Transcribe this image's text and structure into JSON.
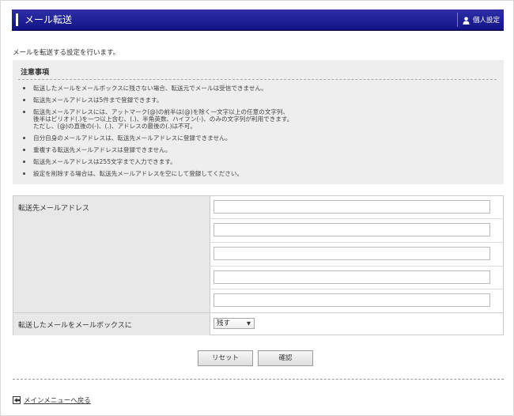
{
  "header": {
    "title": "メール転送",
    "profile_label": "個人設定"
  },
  "intro": "メールを転送する設定を行います。",
  "notice": {
    "heading": "注意事項",
    "items": [
      [
        "転送したメールをメールボックスに残さない場合、転送元でメールは受信できません。"
      ],
      [
        "転送先メールアドレスは5件まで登録できます。"
      ],
      [
        "転送先メールアドレスには、アットマーク(@)の前半は(@)を除く一文字以上の任意の文字列、",
        "後半はピリオド(.)を一つ以上含む、(.)、半角英数、ハイフン(-)、のみの文字列が利用できます。",
        "ただし、(@)の直後の(-)、(.)、アドレスの最後の(.)は不可。"
      ],
      [
        "自分自身のメールアドレスは、転送先メールアドレスに登録できません。"
      ],
      [
        "重複する転送先メールアドレスは登録できません。"
      ],
      [
        "転送先メールアドレスは255文字まで入力できます。"
      ],
      [
        "設定を削除する場合は、転送先メールアドレスを空にして登録してください。"
      ]
    ]
  },
  "form": {
    "address_label": "転送先メールアドレス",
    "addresses": [
      "",
      "",
      "",
      "",
      ""
    ],
    "keep_label": "転送したメールをメールボックスに",
    "keep_selected": "残す"
  },
  "buttons": {
    "reset": "リセット",
    "confirm": "確認"
  },
  "back_link": "メインメニューへ戻る"
}
